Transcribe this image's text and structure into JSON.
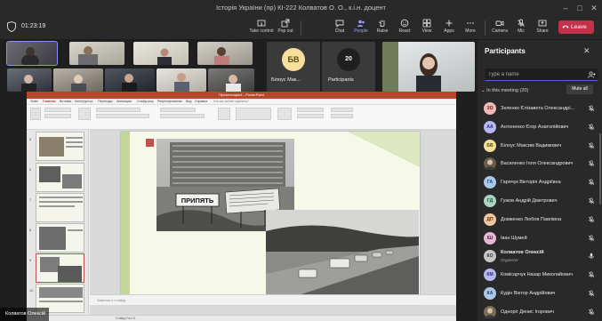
{
  "window": {
    "title": "Історія України (пр) КІ-222 Колватов О. О., к.і.н. доцент"
  },
  "toolbar": {
    "timer": "01:23:19",
    "items": [
      {
        "label": "Take control"
      },
      {
        "label": "Pop out"
      },
      {
        "label": "Chat"
      },
      {
        "label": "People"
      },
      {
        "label": "Raise"
      },
      {
        "label": "React"
      },
      {
        "label": "View"
      },
      {
        "label": "Apps"
      },
      {
        "label": "More"
      },
      {
        "label": "Camera"
      },
      {
        "label": "Mic"
      },
      {
        "label": "Share"
      }
    ],
    "leave_label": "Leave",
    "leave_color": "#c4314b",
    "accent_color": "#9ea2ff"
  },
  "gallery": {
    "avatar_tile": {
      "initials": "БВ",
      "name": "Білоус Мак..."
    },
    "overflow_tile": {
      "count": "20",
      "label": "Participants"
    }
  },
  "share": {
    "app_title": "Презентация1 - PowerPoint",
    "tabs": [
      "Файл",
      "Главная",
      "Вставка",
      "Конструктор",
      "Переходы",
      "Анимация",
      "Слайд-шоу",
      "Рецензирование",
      "Вид",
      "Справка"
    ],
    "tell_me": "Что вы хотите сделать?",
    "slide_numbers": [
      "5",
      "6",
      "7",
      "8",
      "9",
      "10",
      "11"
    ],
    "notes_placeholder": "Заметки к слайду",
    "sign_text": "ПРИПЯТЬ",
    "status_text": "Слайд 9 из 11",
    "speaker_name": "Колватов Олексій"
  },
  "panel": {
    "title": "Participants",
    "search_placeholder": "Type a name",
    "in_meeting_label": "In this meeting (20)",
    "mute_all_label": "Mute all",
    "participants": [
      {
        "initials": "ЗО",
        "name": "Зеленко Єлізавета Олександрі...",
        "role": "",
        "color": "#f2b8b5",
        "text_color": "#5c1a16"
      },
      {
        "initials": "АА",
        "name": "Антоненко Єгор Анатолійович",
        "role": "",
        "color": "#b9b7f3",
        "text_color": "#2d2a7a"
      },
      {
        "initials": "БВ",
        "name": "Білоус Максим Вадимович",
        "role": "",
        "color": "#f5df9a",
        "text_color": "#5a4a0d"
      },
      {
        "initials": "",
        "name": "Василенко Ілля Олександрович",
        "role": "",
        "color": "#6a5a4a",
        "text_color": "#ffffff"
      },
      {
        "initials": "ГА",
        "name": "Гарячук Вікторія Андріївна",
        "role": "",
        "color": "#a9c7e8",
        "text_color": "#1e3c5c"
      },
      {
        "initials": "ГД",
        "name": "Гужов Андрій Дмитрович",
        "role": "",
        "color": "#a9d4c2",
        "text_color": "#1c4a38"
      },
      {
        "initials": "ДП",
        "name": "Довженко Любов Павлівна",
        "role": "",
        "color": "#f0c8a0",
        "text_color": "#5a3010"
      },
      {
        "initials": "ІШ",
        "name": "Іван Шумей",
        "role": "",
        "color": "#e9b6d6",
        "text_color": "#5a1f45"
      },
      {
        "initials": "КО",
        "name": "Колватов Олексій",
        "role": "Organizer",
        "color": "#c5c5c5",
        "text_color": "#333333"
      },
      {
        "initials": "КМ",
        "name": "Комісарчук Назар Миколайович",
        "role": "",
        "color": "#b9b7f3",
        "text_color": "#2d2a7a"
      },
      {
        "initials": "КА",
        "name": "Кудін Віктор Андрійович",
        "role": "",
        "color": "#a9c7e8",
        "text_color": "#1e3c5c"
      },
      {
        "initials": "",
        "name": "Одноріг Денис Ігорович",
        "role": "",
        "color": "#7a6a58",
        "text_color": "#ffffff"
      }
    ]
  }
}
